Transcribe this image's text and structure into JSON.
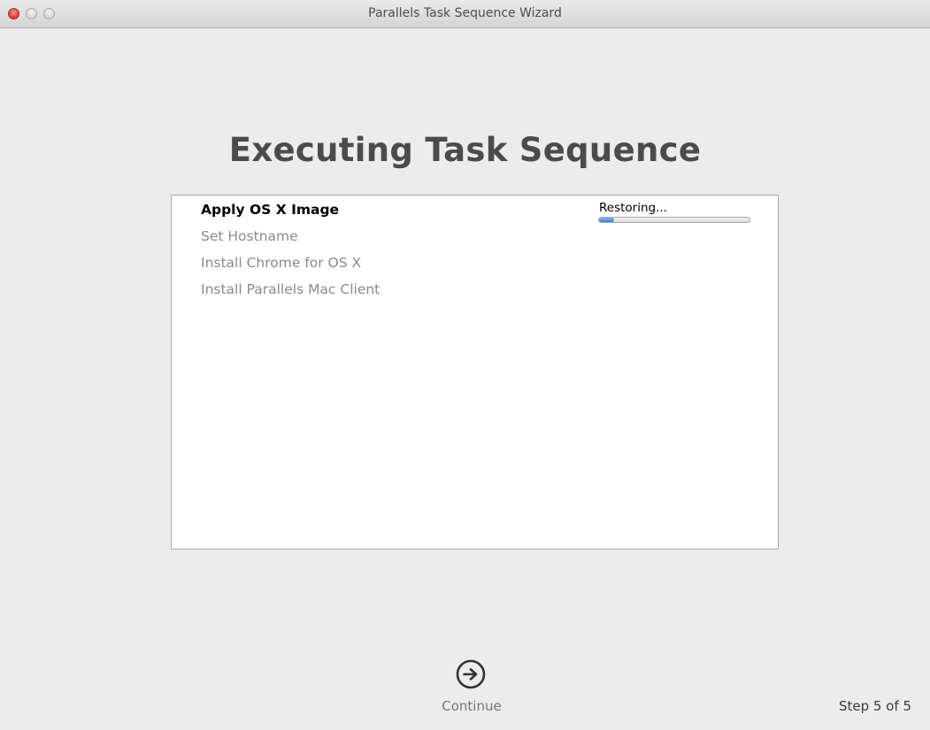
{
  "window": {
    "title": "Parallels Task Sequence Wizard"
  },
  "page": {
    "heading": "Executing Task Sequence"
  },
  "tasks": [
    {
      "label": "Apply OS X Image",
      "state": "active"
    },
    {
      "label": "Set Hostname",
      "state": "pending"
    },
    {
      "label": "Install Chrome for OS X",
      "state": "pending"
    },
    {
      "label": "Install Parallels Mac Client",
      "state": "pending"
    }
  ],
  "current_task": {
    "status": "Restoring...",
    "progress": 0.1
  },
  "footer": {
    "continue_label": "Continue",
    "step_text": "Step 5 of 5"
  },
  "colors": {
    "close_button": "#e0433a",
    "progress_fill": "#3b7fd8",
    "active_task_text": "#000000",
    "pending_task_text": "#8a8a8a"
  }
}
